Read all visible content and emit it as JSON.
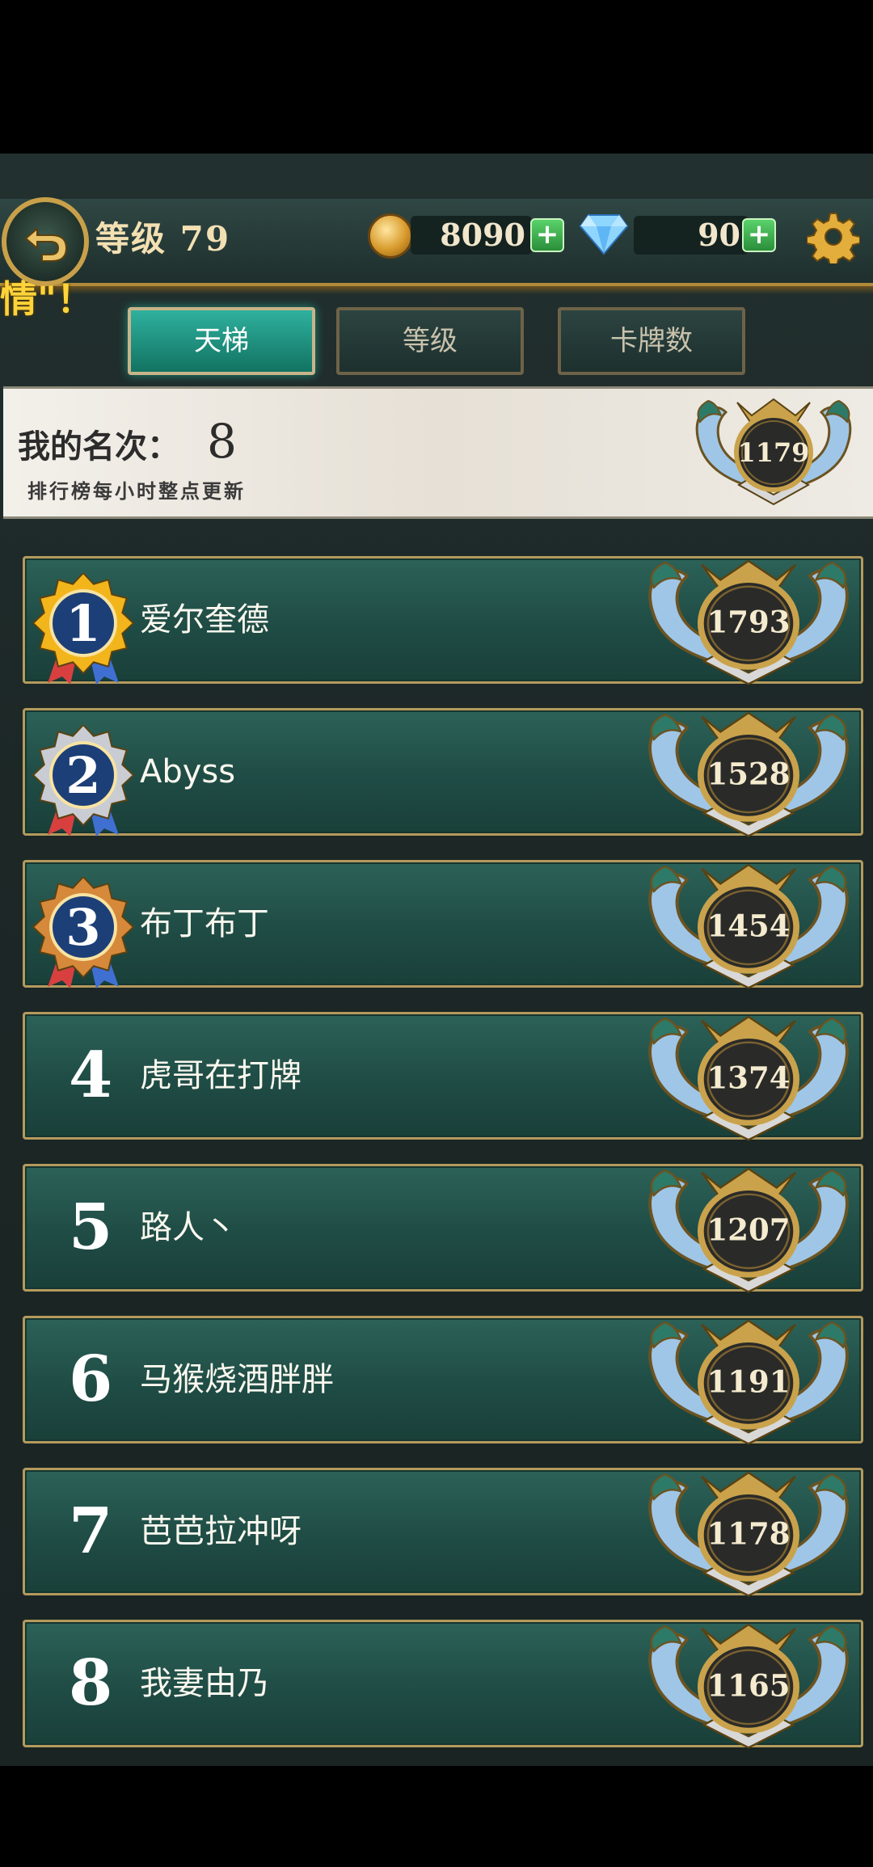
{
  "header": {
    "level_label": "等级 79",
    "scroll_text": "情\"！",
    "gold": "8090",
    "diamonds": "90",
    "plus": "+"
  },
  "tabs": [
    {
      "label": "天梯",
      "active": true
    },
    {
      "label": "等级",
      "active": false
    },
    {
      "label": "卡牌数",
      "active": false
    }
  ],
  "my_rank": {
    "label": "我的名次：",
    "value": "8",
    "note": "排行榜每小时整点更新",
    "score": "1179"
  },
  "leaderboard": [
    {
      "rank": "1",
      "name": "爱尔奎德",
      "score": "1793",
      "medal": "gold"
    },
    {
      "rank": "2",
      "name": "Abyss",
      "score": "1528",
      "medal": "silver"
    },
    {
      "rank": "3",
      "name": "布丁布丁",
      "score": "1454",
      "medal": "bronze"
    },
    {
      "rank": "4",
      "name": "虎哥在打牌",
      "score": "1374"
    },
    {
      "rank": "5",
      "name": "路人丶",
      "score": "1207"
    },
    {
      "rank": "6",
      "name": "马猴烧酒胖胖",
      "score": "1191"
    },
    {
      "rank": "7",
      "name": "芭芭拉冲呀",
      "score": "1178"
    },
    {
      "rank": "8",
      "name": "我妻由乃",
      "score": "1165"
    }
  ],
  "colors": {
    "medal_gold": "#f2b51c",
    "medal_silver": "#c9ccd2",
    "medal_bronze": "#d6893a",
    "medal_center": "#1d3f78"
  }
}
